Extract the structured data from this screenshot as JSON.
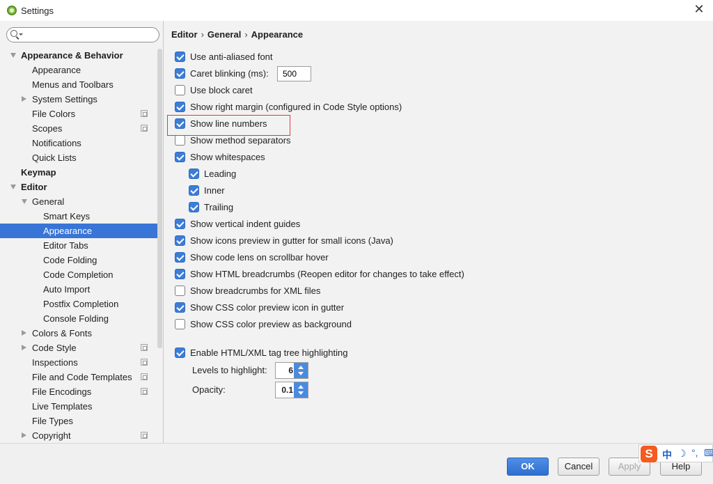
{
  "window": {
    "title": "Settings"
  },
  "search": {
    "value": "",
    "placeholder": ""
  },
  "sidebar": {
    "items": [
      {
        "label": "Appearance & Behavior",
        "level": 0,
        "arrow": "down",
        "bold": true
      },
      {
        "label": "Appearance",
        "level": 1
      },
      {
        "label": "Menus and Toolbars",
        "level": 1
      },
      {
        "label": "System Settings",
        "level": 1,
        "arrow": "right"
      },
      {
        "label": "File Colors",
        "level": 1,
        "project": true
      },
      {
        "label": "Scopes",
        "level": 1,
        "project": true
      },
      {
        "label": "Notifications",
        "level": 1
      },
      {
        "label": "Quick Lists",
        "level": 1
      },
      {
        "label": "Keymap",
        "level": 0,
        "bold": true
      },
      {
        "label": "Editor",
        "level": 0,
        "arrow": "down",
        "bold": true
      },
      {
        "label": "General",
        "level": 1,
        "arrow": "down"
      },
      {
        "label": "Smart Keys",
        "level": 2
      },
      {
        "label": "Appearance",
        "level": 2,
        "selected": true
      },
      {
        "label": "Editor Tabs",
        "level": 2
      },
      {
        "label": "Code Folding",
        "level": 2
      },
      {
        "label": "Code Completion",
        "level": 2
      },
      {
        "label": "Auto Import",
        "level": 2
      },
      {
        "label": "Postfix Completion",
        "level": 2
      },
      {
        "label": "Console Folding",
        "level": 2
      },
      {
        "label": "Colors & Fonts",
        "level": 1,
        "arrow": "right"
      },
      {
        "label": "Code Style",
        "level": 1,
        "arrow": "right",
        "project": true
      },
      {
        "label": "Inspections",
        "level": 1,
        "project": true
      },
      {
        "label": "File and Code Templates",
        "level": 1,
        "project": true
      },
      {
        "label": "File Encodings",
        "level": 1,
        "project": true
      },
      {
        "label": "Live Templates",
        "level": 1
      },
      {
        "label": "File Types",
        "level": 1
      },
      {
        "label": "Copyright",
        "level": 1,
        "arrow": "right",
        "project": true
      }
    ]
  },
  "breadcrumb": {
    "items": [
      "Editor",
      "General",
      "Appearance"
    ],
    "separator": "›"
  },
  "options": [
    {
      "label": "Use anti-aliased font",
      "checked": true,
      "indent": 0
    },
    {
      "label": "Caret blinking (ms):",
      "checked": true,
      "indent": 0
    },
    {
      "label": "Use block caret",
      "checked": false,
      "indent": 0
    },
    {
      "label": "Show right margin (configured in Code Style options)",
      "checked": true,
      "indent": 0
    },
    {
      "label": "Show line numbers",
      "checked": true,
      "indent": 0
    },
    {
      "label": "Show method separators",
      "checked": false,
      "indent": 0
    },
    {
      "label": "Show whitespaces",
      "checked": true,
      "indent": 0
    },
    {
      "label": "Leading",
      "checked": true,
      "indent": 1
    },
    {
      "label": "Inner",
      "checked": true,
      "indent": 1
    },
    {
      "label": "Trailing",
      "checked": true,
      "indent": 1
    },
    {
      "label": "Show vertical indent guides",
      "checked": true,
      "indent": 0
    },
    {
      "label": "Show icons preview in gutter for small icons (Java)",
      "checked": true,
      "indent": 0
    },
    {
      "label": "Show code lens on scrollbar hover",
      "checked": true,
      "indent": 0
    },
    {
      "label": "Show HTML breadcrumbs (Reopen editor for changes to take effect)",
      "checked": true,
      "indent": 0
    },
    {
      "label": "Show breadcrumbs for XML files",
      "checked": false,
      "indent": 0
    },
    {
      "label": "Show CSS color preview icon in gutter",
      "checked": true,
      "indent": 0
    },
    {
      "label": "Show CSS color preview as background",
      "checked": false,
      "indent": 0
    }
  ],
  "caret_blinking": {
    "value": "500"
  },
  "tag_tree": {
    "label": "Enable HTML/XML tag tree highlighting",
    "checked": true,
    "levels_label": "Levels to highlight:",
    "levels_value": "6",
    "opacity_label": "Opacity:",
    "opacity_value": "0.1"
  },
  "footer": {
    "ok": "OK",
    "cancel": "Cancel",
    "apply": "Apply",
    "help": "Help"
  },
  "ime": {
    "logo": "S",
    "lang": "中",
    "moon": "☽",
    "punct": "°,",
    "keyboard": "⌨"
  },
  "colors": {
    "accent": "#3875d6",
    "checkbox": "#3b7dd8",
    "highlight": "#e03a3a"
  }
}
